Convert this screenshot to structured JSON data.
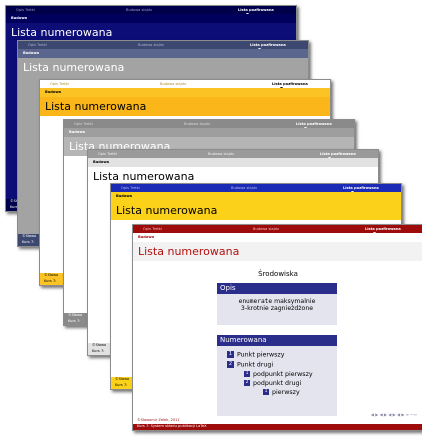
{
  "common": {
    "header_left": "Opis Tretki",
    "header_center": "Budowa slajdu",
    "header_right": "Lista pozfirowana",
    "section": "Budowa",
    "slide_title": "Lista numerowana",
    "footer_author": "©Sławomir Zelek, 2011",
    "footer_course": "Kurs 7: System składu publikacji LaTeX",
    "footer_author_short": "©Sławo",
    "footer_course_short": "Kurs 7:"
  },
  "front": {
    "environment_heading": "Środowiska",
    "block_opis_title": "Opis",
    "block_opis_code": "enumerate",
    "block_opis_text1": " maksymalnie",
    "block_opis_text2": "3-krotnie zagnieżdżone",
    "block_list_title": "Numerowana",
    "items": [
      {
        "num": "1",
        "label": "Punkt pierwszy"
      },
      {
        "num": "2",
        "label": "Punkt drugi"
      }
    ],
    "subitems": [
      {
        "num": "1",
        "label": "podpunkt pierwszy"
      },
      {
        "num": "2",
        "label": "podpunkt drugi"
      }
    ],
    "subsubitems": [
      {
        "num": "1",
        "label": "pierwszy"
      }
    ],
    "nav_symbols": "◀ ▶ ◀ ▶ ◀ ▶ ◀ ▶ ≡ ∽∾"
  },
  "colors": {
    "navy": "#0d0d78",
    "slate": "#3d4870",
    "yellow": "#fbc424",
    "gray": "#8a8a8a",
    "blue": "#1c2bb5",
    "red": "#9d0b0b",
    "block": "#2b2d8a"
  }
}
